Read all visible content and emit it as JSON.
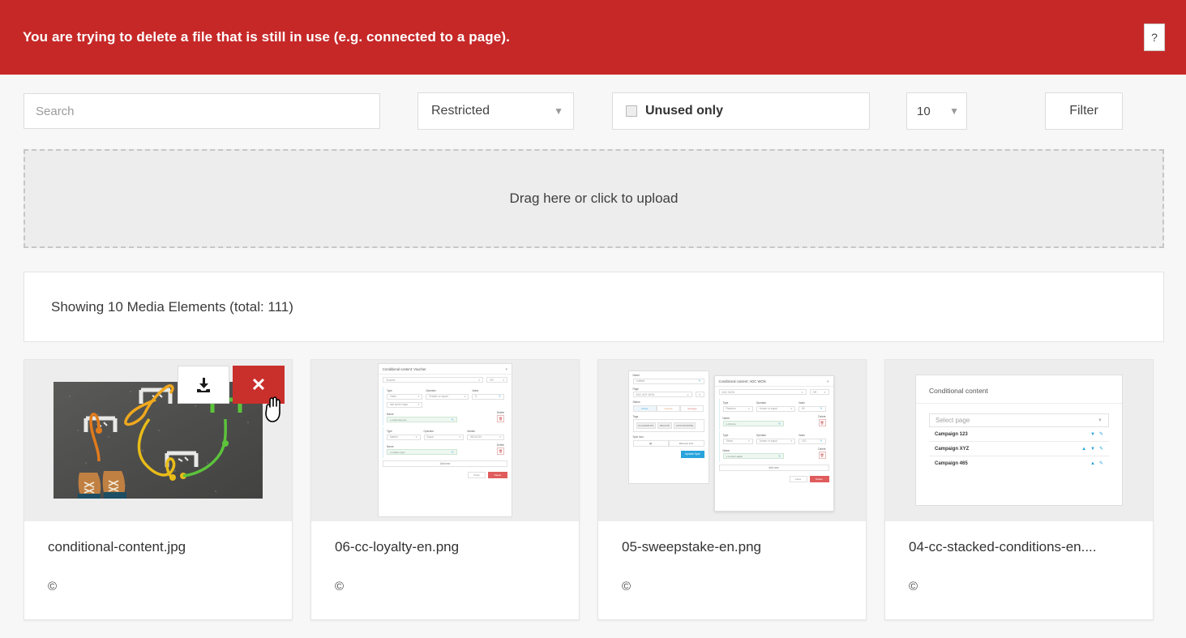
{
  "banner": {
    "message": "You are trying to delete a file that is still in use (e.g. connected to a page).",
    "help_label": "?",
    "background_color": "#c62828"
  },
  "toolbar": {
    "search_placeholder": "Search",
    "search_value": "",
    "restricted_select": {
      "value": "Restricted",
      "caret": "▼"
    },
    "unused_only": {
      "label": "Unused only",
      "checked": false
    },
    "page_size_select": {
      "value": "10",
      "caret": "▼"
    },
    "filter_button": "Filter"
  },
  "dropzone": {
    "label": "Drag here or click to upload"
  },
  "count_bar": {
    "text": "Showing 10 Media Elements (total: 111)"
  },
  "cards": [
    {
      "filename": "conditional-content.jpg",
      "copyright": "©",
      "thumb_type": "photo",
      "actions": {
        "download": "download-icon",
        "delete": "✕"
      }
    },
    {
      "filename": "06-cc-loyalty-en.png",
      "copyright": "©",
      "thumb_type": "mock-dialog-voucher"
    },
    {
      "filename": "05-sweepstake-en.png",
      "copyright": "©",
      "thumb_type": "mock-dialog-adcwon"
    },
    {
      "filename": "04-cc-stacked-conditions-en....",
      "copyright": "©",
      "thumb_type": "mock-conditional-content"
    }
  ],
  "thumb_voucher": {
    "title": "Conditional content: Voucher",
    "close": "×",
    "select_value": "Voucher",
    "unit": "OR",
    "labels": {
      "type": "Type",
      "operator": "Operator",
      "value": "Value",
      "name": "Name",
      "delete": "Delete",
      "marker": "Marker",
      "required": "required"
    },
    "row1": {
      "type": "Visits",
      "operator": "Greater or equal",
      "value": "5",
      "subtype": "last seven days",
      "name": "x-visits-last-sev"
    },
    "row2": {
      "type": "Marker",
      "operator": "Equal",
      "marker": "BEACON",
      "name": "x-marker-type"
    },
    "add_new": "Add new",
    "close_btn": "Close",
    "delete_btn": "Delete"
  },
  "thumb_adcwon": {
    "left": {
      "name_label": "Name",
      "name_value": "Untitled",
      "page_label": "Page",
      "page_value": "ADC ACE WON",
      "status_label": "Status",
      "status_options": [
        "Active",
        "Inactive",
        "Garbage"
      ],
      "tags_label": "Tags",
      "tags": [
        "KLAGENFURT",
        "BEACON",
        "GASTRONOMIE"
      ],
      "spot_icon_label": "Spot Icon",
      "remove_icon": "Remove icon",
      "update_button": "Update Spot"
    },
    "right": {
      "title": "Conditional content: ADC WON",
      "close": "×",
      "select_value": "ADC WON",
      "unit": "OR",
      "labels": {
        "type": "Type",
        "operator": "Operator",
        "value": "Value",
        "name": "Name",
        "delete": "Delete"
      },
      "row1": {
        "type": "Random",
        "operator": "Lesser or equal",
        "value": "50",
        "name": "x-chance"
      },
      "row2": {
        "type": "Views",
        "operator": "Lesser or equal",
        "value": "100",
        "name": "x-content-again"
      },
      "add_new": "Add new",
      "close_btn": "Close",
      "delete_btn": "Delete"
    }
  },
  "thumb_conditional": {
    "title": "Conditional content",
    "select_placeholder": "Select page",
    "rows": [
      {
        "name": "Campaign 123",
        "icons": [
          "▼",
          "pencil"
        ]
      },
      {
        "name": "Campaign XYZ",
        "icons": [
          "▲",
          "▼",
          "pencil"
        ]
      },
      {
        "name": "Campaign 465",
        "icons": [
          "▲",
          "pencil"
        ]
      }
    ]
  }
}
